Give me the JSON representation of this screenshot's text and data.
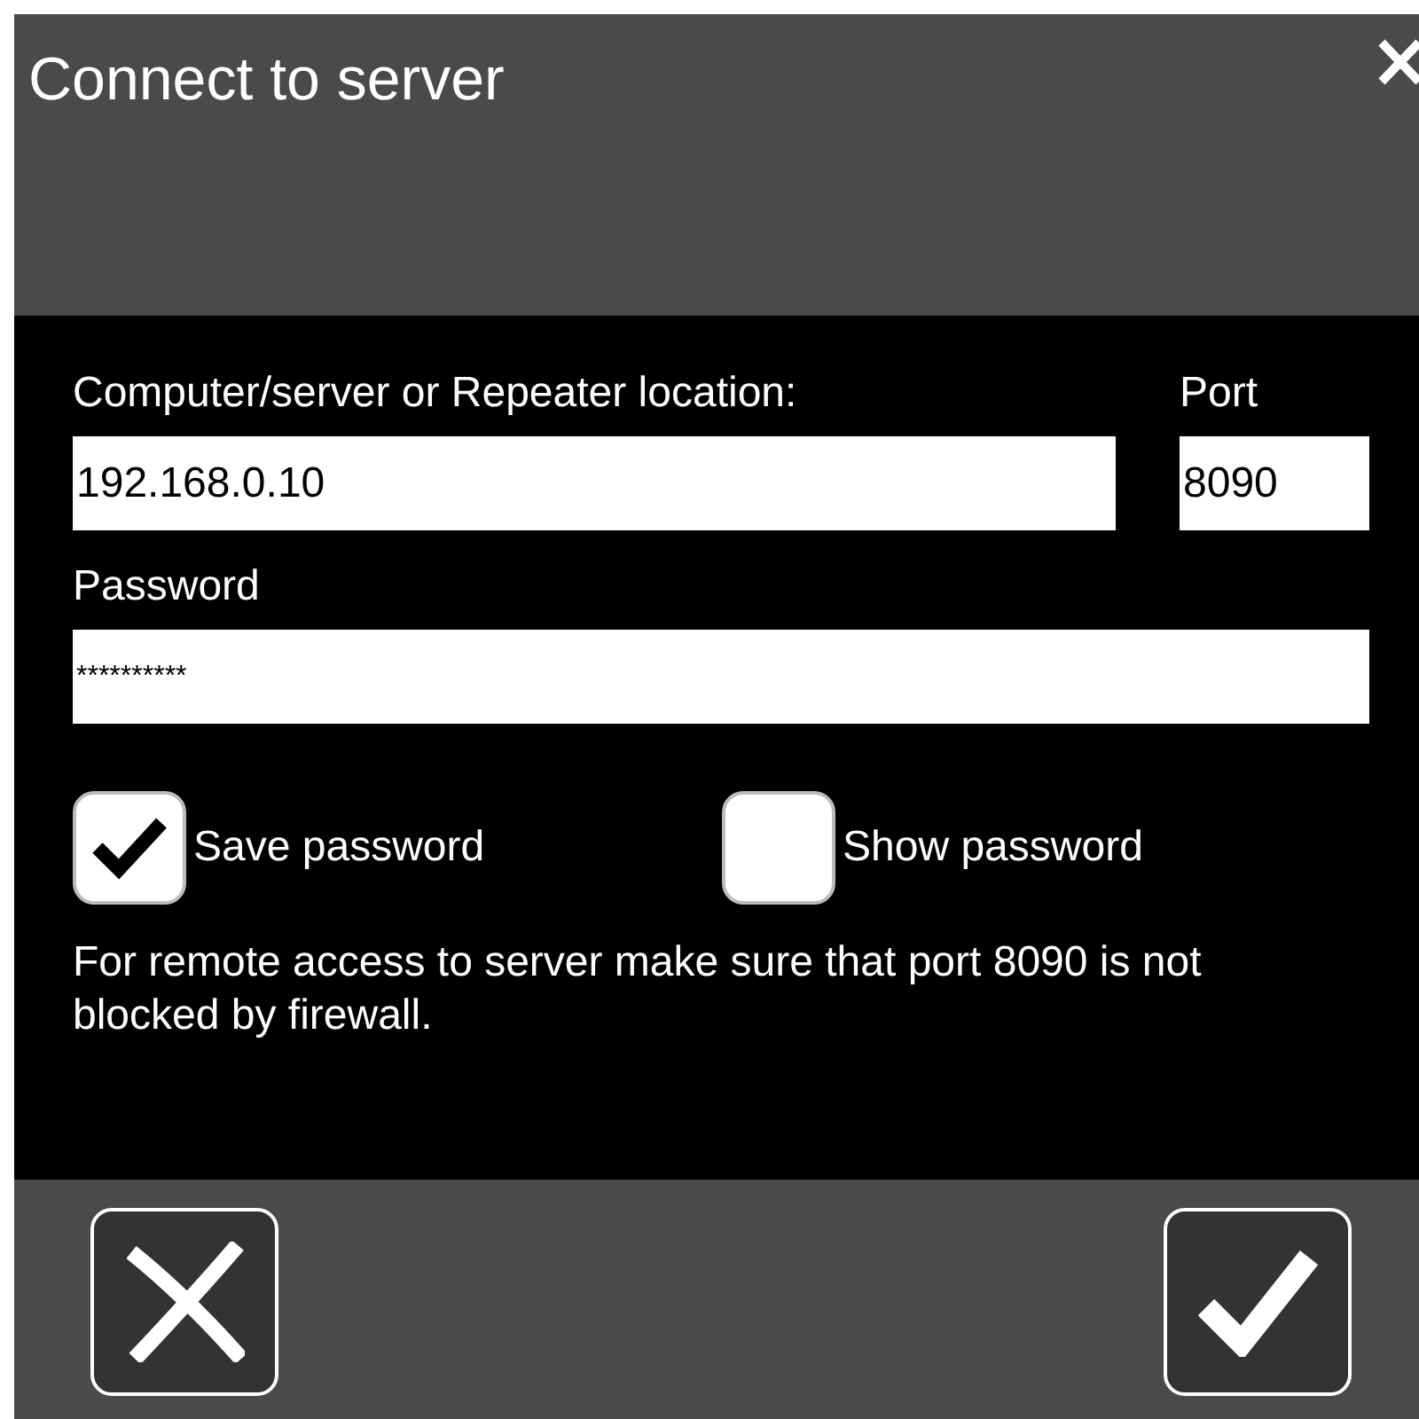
{
  "window": {
    "title": "Connect to server"
  },
  "location": {
    "label": "Computer/server or Repeater location:",
    "value": "192.168.0.10"
  },
  "port": {
    "label": "Port",
    "value": "8090"
  },
  "password": {
    "label": "Password",
    "value": "**********"
  },
  "options": [
    {
      "label": "Save password",
      "checked": true
    },
    {
      "label": "Show password",
      "checked": false
    }
  ],
  "note": "For remote access to server make sure that port 8090 is not blocked by firewall."
}
